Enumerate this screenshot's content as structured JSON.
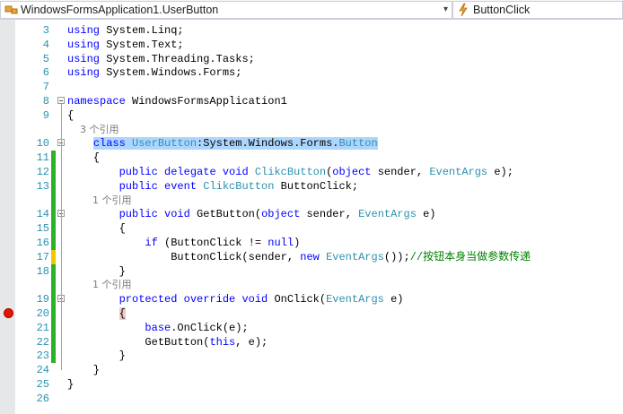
{
  "navbar": {
    "class_combo": "WindowsFormsApplication1.UserButton",
    "member_combo": "ButtonClick"
  },
  "lines": [
    {
      "n": "3",
      "segs": [
        {
          "t": "using",
          "c": "kw"
        },
        {
          "t": " System.Linq;"
        }
      ]
    },
    {
      "n": "4",
      "segs": [
        {
          "t": "using",
          "c": "kw"
        },
        {
          "t": " System.Text;"
        }
      ]
    },
    {
      "n": "5",
      "segs": [
        {
          "t": "using",
          "c": "kw"
        },
        {
          "t": " System.Threading.Tasks;"
        }
      ]
    },
    {
      "n": "6",
      "segs": [
        {
          "t": "using",
          "c": "kw"
        },
        {
          "t": " System.Windows.Forms;"
        }
      ]
    },
    {
      "n": "7",
      "segs": []
    },
    {
      "n": "8",
      "fold": true,
      "segs": [
        {
          "t": "namespace",
          "c": "kw"
        },
        {
          "t": " WindowsFormsApplication1"
        }
      ]
    },
    {
      "n": "9",
      "segs": [
        {
          "t": "{"
        }
      ]
    },
    {
      "lens": "    3 个引用"
    },
    {
      "n": "10",
      "fold": true,
      "segs": [
        {
          "t": "    "
        },
        {
          "t": "class",
          "c": "kw sel"
        },
        {
          "t": " ",
          "c": "sel"
        },
        {
          "t": "UserButton",
          "c": "ty sel"
        },
        {
          "t": ":System.Windows.Forms.",
          "c": "sel"
        },
        {
          "t": "Button",
          "c": "ty sel"
        }
      ]
    },
    {
      "n": "11",
      "chg": "green",
      "segs": [
        {
          "t": "    {"
        }
      ]
    },
    {
      "n": "12",
      "chg": "green",
      "segs": [
        {
          "t": "        "
        },
        {
          "t": "public",
          "c": "kw"
        },
        {
          "t": " "
        },
        {
          "t": "delegate",
          "c": "kw"
        },
        {
          "t": " "
        },
        {
          "t": "void",
          "c": "kw"
        },
        {
          "t": " "
        },
        {
          "t": "ClikcButton",
          "c": "ty"
        },
        {
          "t": "("
        },
        {
          "t": "object",
          "c": "kw"
        },
        {
          "t": " sender, "
        },
        {
          "t": "EventArgs",
          "c": "ty"
        },
        {
          "t": " e);"
        }
      ]
    },
    {
      "n": "13",
      "chg": "green",
      "segs": [
        {
          "t": "        "
        },
        {
          "t": "public",
          "c": "kw"
        },
        {
          "t": " "
        },
        {
          "t": "event",
          "c": "kw"
        },
        {
          "t": " "
        },
        {
          "t": "ClikcButton",
          "c": "ty"
        },
        {
          "t": " ButtonClick;"
        }
      ]
    },
    {
      "lens": "        1 个引用",
      "chg": "green"
    },
    {
      "n": "14",
      "fold": true,
      "chg": "green",
      "segs": [
        {
          "t": "        "
        },
        {
          "t": "public",
          "c": "kw"
        },
        {
          "t": " "
        },
        {
          "t": "void",
          "c": "kw"
        },
        {
          "t": " GetButton("
        },
        {
          "t": "object",
          "c": "kw"
        },
        {
          "t": " sender, "
        },
        {
          "t": "EventArgs",
          "c": "ty"
        },
        {
          "t": " e)"
        }
      ]
    },
    {
      "n": "15",
      "chg": "green",
      "segs": [
        {
          "t": "        {"
        }
      ]
    },
    {
      "n": "16",
      "chg": "green",
      "segs": [
        {
          "t": "            "
        },
        {
          "t": "if",
          "c": "kw"
        },
        {
          "t": " (ButtonClick != "
        },
        {
          "t": "null",
          "c": "kw"
        },
        {
          "t": ")"
        }
      ]
    },
    {
      "n": "17",
      "chg": "yellow",
      "segs": [
        {
          "t": "                ButtonClick(sender, "
        },
        {
          "t": "new",
          "c": "kw"
        },
        {
          "t": " "
        },
        {
          "t": "EventArgs",
          "c": "ty"
        },
        {
          "t": "());"
        },
        {
          "t": "//按钮本身当做参数传递",
          "c": "cm"
        }
      ]
    },
    {
      "n": "18",
      "chg": "green",
      "segs": [
        {
          "t": "        }"
        }
      ]
    },
    {
      "lens": "        1 个引用",
      "chg": "green"
    },
    {
      "n": "19",
      "fold": true,
      "chg": "green",
      "segs": [
        {
          "t": "        "
        },
        {
          "t": "protected",
          "c": "kw"
        },
        {
          "t": " "
        },
        {
          "t": "override",
          "c": "kw"
        },
        {
          "t": " "
        },
        {
          "t": "void",
          "c": "kw"
        },
        {
          "t": " OnClick("
        },
        {
          "t": "EventArgs",
          "c": "ty"
        },
        {
          "t": " e)"
        }
      ]
    },
    {
      "n": "20",
      "bp": true,
      "chg": "green",
      "segs": [
        {
          "t": "        "
        },
        {
          "t": "{",
          "c": "hl"
        }
      ]
    },
    {
      "n": "21",
      "chg": "green",
      "segs": [
        {
          "t": "            "
        },
        {
          "t": "base",
          "c": "kw"
        },
        {
          "t": ".OnClick(e);"
        }
      ]
    },
    {
      "n": "22",
      "chg": "green",
      "segs": [
        {
          "t": "            GetButton("
        },
        {
          "t": "this",
          "c": "kw"
        },
        {
          "t": ", e);"
        }
      ]
    },
    {
      "n": "23",
      "chg": "green",
      "segs": [
        {
          "t": "        }"
        }
      ]
    },
    {
      "n": "24",
      "segs": [
        {
          "t": "    }"
        }
      ]
    },
    {
      "n": "25",
      "segs": [
        {
          "t": "}"
        }
      ]
    },
    {
      "n": "26",
      "segs": []
    }
  ]
}
